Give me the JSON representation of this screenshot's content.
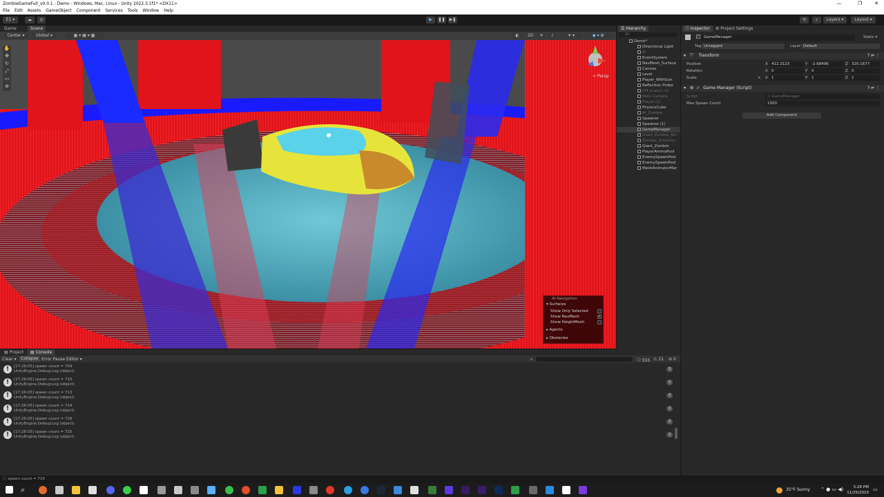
{
  "window": {
    "title": "ZombieGameFull_v0.0.1 - Demo - Windows, Mac, Linux - Unity 2022.3.1f1* <DX11>",
    "controls": [
      "—",
      "❐",
      "✕"
    ]
  },
  "menu": [
    "File",
    "Edit",
    "Assets",
    "GameObject",
    "Component",
    "Services",
    "Tools",
    "Window",
    "Help"
  ],
  "toolbar": {
    "account": "E1 ▾",
    "play": "▶",
    "pause": "❚❚",
    "step": "▶❚",
    "layers": "Layers ▾",
    "layout": "Layout ▾"
  },
  "scene_tabs": [
    "Game",
    "Scene"
  ],
  "scene_tools": {
    "pivot": "Center ▾",
    "space": "Global ▾",
    "mode_2d": "2D",
    "gizmo_label": "< Persp"
  },
  "hierarchy": {
    "tab": "Hierarchy",
    "search_placeholder": "All",
    "items": [
      {
        "label": "Demo*",
        "dim": false,
        "indent": 0
      },
      {
        "label": "Directional Light",
        "dim": false,
        "indent": 1
      },
      {
        "label": "AI",
        "dim": true,
        "indent": 1
      },
      {
        "label": "EventSystem",
        "dim": false,
        "indent": 1
      },
      {
        "label": "NavMesh_Surface",
        "dim": false,
        "indent": 1
      },
      {
        "label": "Canvas",
        "dim": false,
        "indent": 1
      },
      {
        "label": "Level",
        "dim": false,
        "indent": 1
      },
      {
        "label": "Player_WithGun",
        "dim": false,
        "indent": 1
      },
      {
        "label": "Reflection Probe",
        "dim": false,
        "indent": 1
      },
      {
        "label": "CM vcam1 (1)",
        "dim": true,
        "indent": 1
      },
      {
        "label": "Main Camera",
        "dim": true,
        "indent": 1
      },
      {
        "label": "Player (1)",
        "dim": true,
        "indent": 1
      },
      {
        "label": "PhysicsCube",
        "dim": false,
        "indent": 1
      },
      {
        "label": "AI_Zombie",
        "dim": true,
        "indent": 1
      },
      {
        "label": "Spawner",
        "dim": false,
        "indent": 1
      },
      {
        "label": "Spawner (1)",
        "dim": false,
        "indent": 1
      },
      {
        "label": "GameManager",
        "dim": false,
        "indent": 1,
        "selected": true
      },
      {
        "label": "Giant_Zombie_Ani",
        "dim": true,
        "indent": 1
      },
      {
        "label": "Zombie_Untextur",
        "dim": true,
        "indent": 1
      },
      {
        "label": "Giant_Zombie",
        "dim": false,
        "indent": 1
      },
      {
        "label": "PlayerAmmoPool",
        "dim": false,
        "indent": 1
      },
      {
        "label": "EnemySpawnPool",
        "dim": false,
        "indent": 1
      },
      {
        "label": "EnemySpawnPool",
        "dim": false,
        "indent": 1
      },
      {
        "label": "MeshAnimatorMar",
        "dim": false,
        "indent": 1
      }
    ]
  },
  "inspector": {
    "tabs": [
      "Inspector",
      "Project Settings"
    ],
    "object_name": "GameManager",
    "static_label": "Static ▾",
    "tag_label": "Tag",
    "tag_value": "Untagged",
    "layer_label": "Layer",
    "layer_value": "Default",
    "transform": {
      "title": "Transform",
      "position_label": "Position",
      "rotation_label": "Rotation",
      "scale_label": "Scale",
      "position": {
        "x": "412.2123",
        "y": "-2.68496",
        "z": "320.1677"
      },
      "rotation": {
        "x": "0",
        "y": "0",
        "z": "0"
      },
      "scale": {
        "x": "1",
        "y": "1",
        "z": "1"
      }
    },
    "script_component": {
      "title": "Game Manager (Script)",
      "script_label": "Script",
      "script_value": "GameManager",
      "field_label": "Max Spawn Count",
      "field_value": "1000"
    },
    "add_component": "Add Component"
  },
  "ai_navigation": {
    "title": "AI Navigation",
    "surfaces": "Surfaces",
    "show_only_selected": "Show Only Selected",
    "show_navmesh": "Show NavMesh",
    "show_heightmesh": "Show HeightMesh",
    "agents": "Agents",
    "obstacles": "Obstacles"
  },
  "console": {
    "tabs": [
      "Project",
      "Console"
    ],
    "toolbar": [
      "Clear ▾",
      "Collapse",
      "Error Pause",
      "Editor ▾"
    ],
    "counts": {
      "logs": "555",
      "warnings": "11",
      "errors": "0"
    },
    "entries": [
      {
        "line1": "[17:26:05] spawn count = 709",
        "line2": "UnityEngine.Debug:Log (object)",
        "count": "3"
      },
      {
        "line1": "[17:26:05] spawn count = 710",
        "line2": "UnityEngine.Debug:Log (object)",
        "count": "3"
      },
      {
        "line1": "[17:26:05] spawn count = 713",
        "line2": "UnityEngine.Debug:Log (object)",
        "count": "3"
      },
      {
        "line1": "[17:26:05] spawn count = 714",
        "line2": "UnityEngine.Debug:Log (object)",
        "count": "3"
      },
      {
        "line1": "[17:26:05] spawn count = 718",
        "line2": "UnityEngine.Debug:Log (object)",
        "count": "3"
      },
      {
        "line1": "[17:26:05] spawn count = 720",
        "line2": "UnityEngine.Debug:Log (object)",
        "count": "3"
      }
    ]
  },
  "status_bar": "spawn count = 716",
  "taskbar": {
    "weather": "35°F  Sunny",
    "time": "5:26 PM",
    "date": "11/25/2023"
  }
}
